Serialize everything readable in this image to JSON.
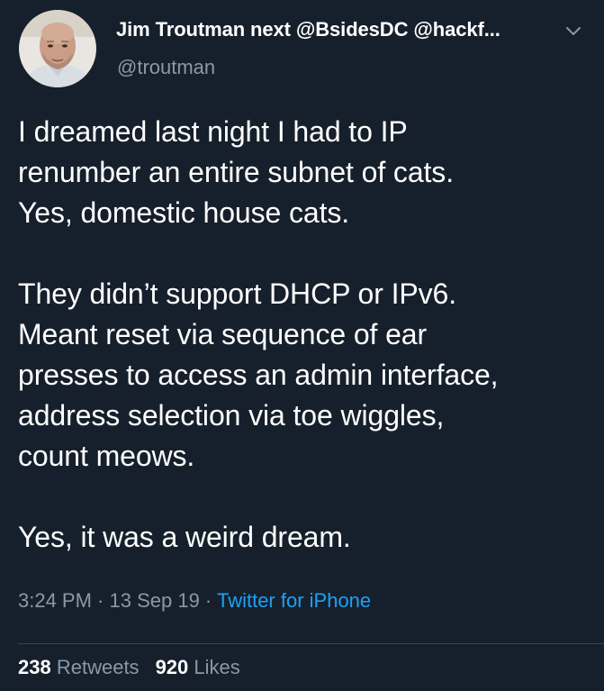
{
  "tweet": {
    "author": {
      "display_name": "Jim Troutman next @BsidesDC @hackf...",
      "handle": "@troutman",
      "avatar_icon": "profile-photo"
    },
    "menu_icon": "chevron-down-icon",
    "paragraphs": [
      "I dreamed last night I had to IP\nrenumber an entire subnet of cats.\nYes, domestic house cats.",
      "They didn’t support DHCP or IPv6.\nMeant reset via sequence of ear\npresses to access an admin interface,\naddress selection via toe wiggles,\ncount meows.",
      "Yes, it was a weird dream."
    ],
    "time": "3:24 PM",
    "separator": " · ",
    "date": "13 Sep 19",
    "source": "Twitter for iPhone",
    "retweets_count": "238",
    "retweets_label": "Retweets",
    "likes_count": "920",
    "likes_label": "Likes"
  },
  "colors": {
    "background": "#16202c",
    "text": "#ffffff",
    "muted": "#8899a6",
    "link": "#1da1f2",
    "divider": "#38444d"
  }
}
